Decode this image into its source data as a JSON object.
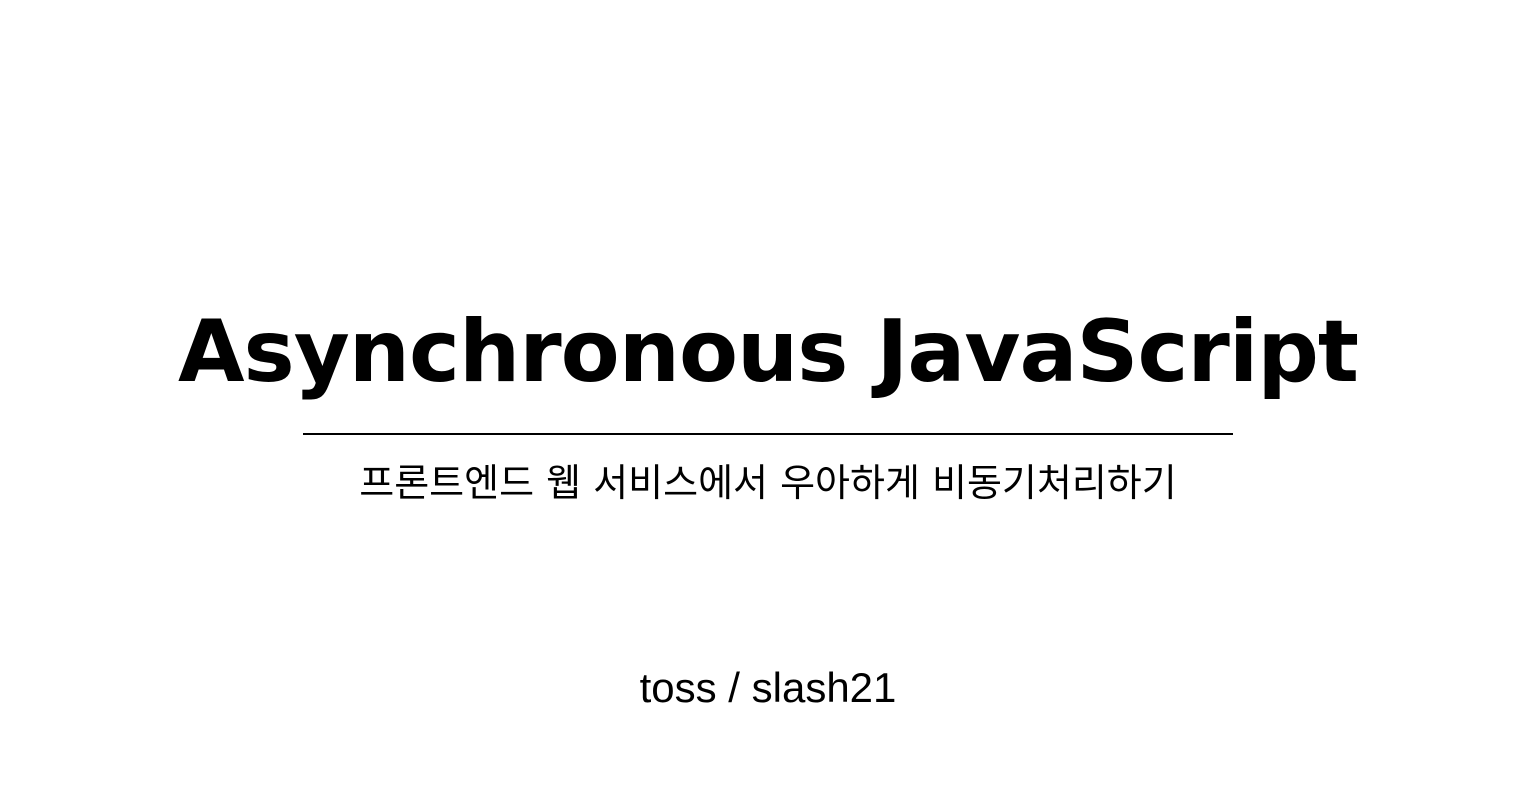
{
  "slide": {
    "title": "Asynchronous JavaScript",
    "subtitle": "프론트엔드 웹 서비스에서 우아하게 비동기처리하기",
    "footer": "toss / slash21"
  }
}
